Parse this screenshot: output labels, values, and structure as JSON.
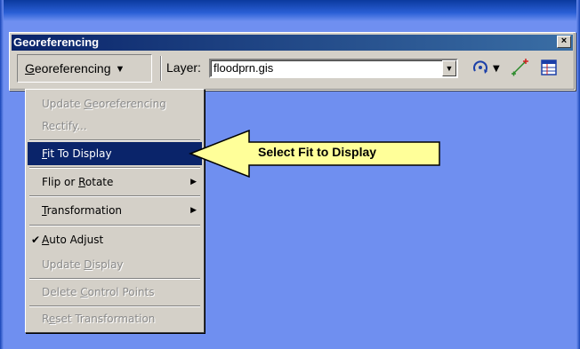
{
  "toolbar": {
    "title": "Georeferencing",
    "close_glyph": "×",
    "menu_button_first": "G",
    "menu_button_rest": "eoreferencing",
    "menu_arrow": "▼",
    "layer_label": "Layer:",
    "layer_value": "floodprn.gis",
    "layer_dropdown_arrow": "▼",
    "rotate_dropdown_arrow": "▼",
    "icons": [
      "rotate-icon",
      "add-control-points-icon",
      "view-link-table-icon"
    ]
  },
  "menu": {
    "items": [
      {
        "pre": "Update ",
        "u": "G",
        "post": "eoreferencing",
        "state": "disabled"
      },
      {
        "pre": "Rectif",
        "u": "y",
        "post": "...",
        "state": "disabled"
      },
      {
        "pre": "",
        "u": "F",
        "post": "it To Display",
        "state": "selected"
      },
      {
        "pre": "Flip or ",
        "u": "R",
        "post": "otate",
        "state": "enabled",
        "submenu": true
      },
      {
        "pre": "",
        "u": "T",
        "post": "ransformation",
        "state": "enabled",
        "submenu": true
      },
      {
        "pre": "",
        "u": "A",
        "post": "uto Adjust",
        "state": "enabled",
        "checked": true
      },
      {
        "pre": "Update ",
        "u": "D",
        "post": "isplay",
        "state": "disabled"
      },
      {
        "pre": "Delete ",
        "u": "C",
        "post": "ontrol Points",
        "state": "disabled"
      },
      {
        "pre": "R",
        "u": "e",
        "post": "set Transformation",
        "state": "disabled"
      }
    ],
    "submenu_arrow": "▶",
    "check_glyph": "✔"
  },
  "callout": {
    "text": "Select Fit to Display"
  },
  "colors": {
    "desktop": "#6f8ff0",
    "title_bar": "#0a246a",
    "menu_highlight": "#0a246a",
    "callout_fill": "#ffff99"
  }
}
